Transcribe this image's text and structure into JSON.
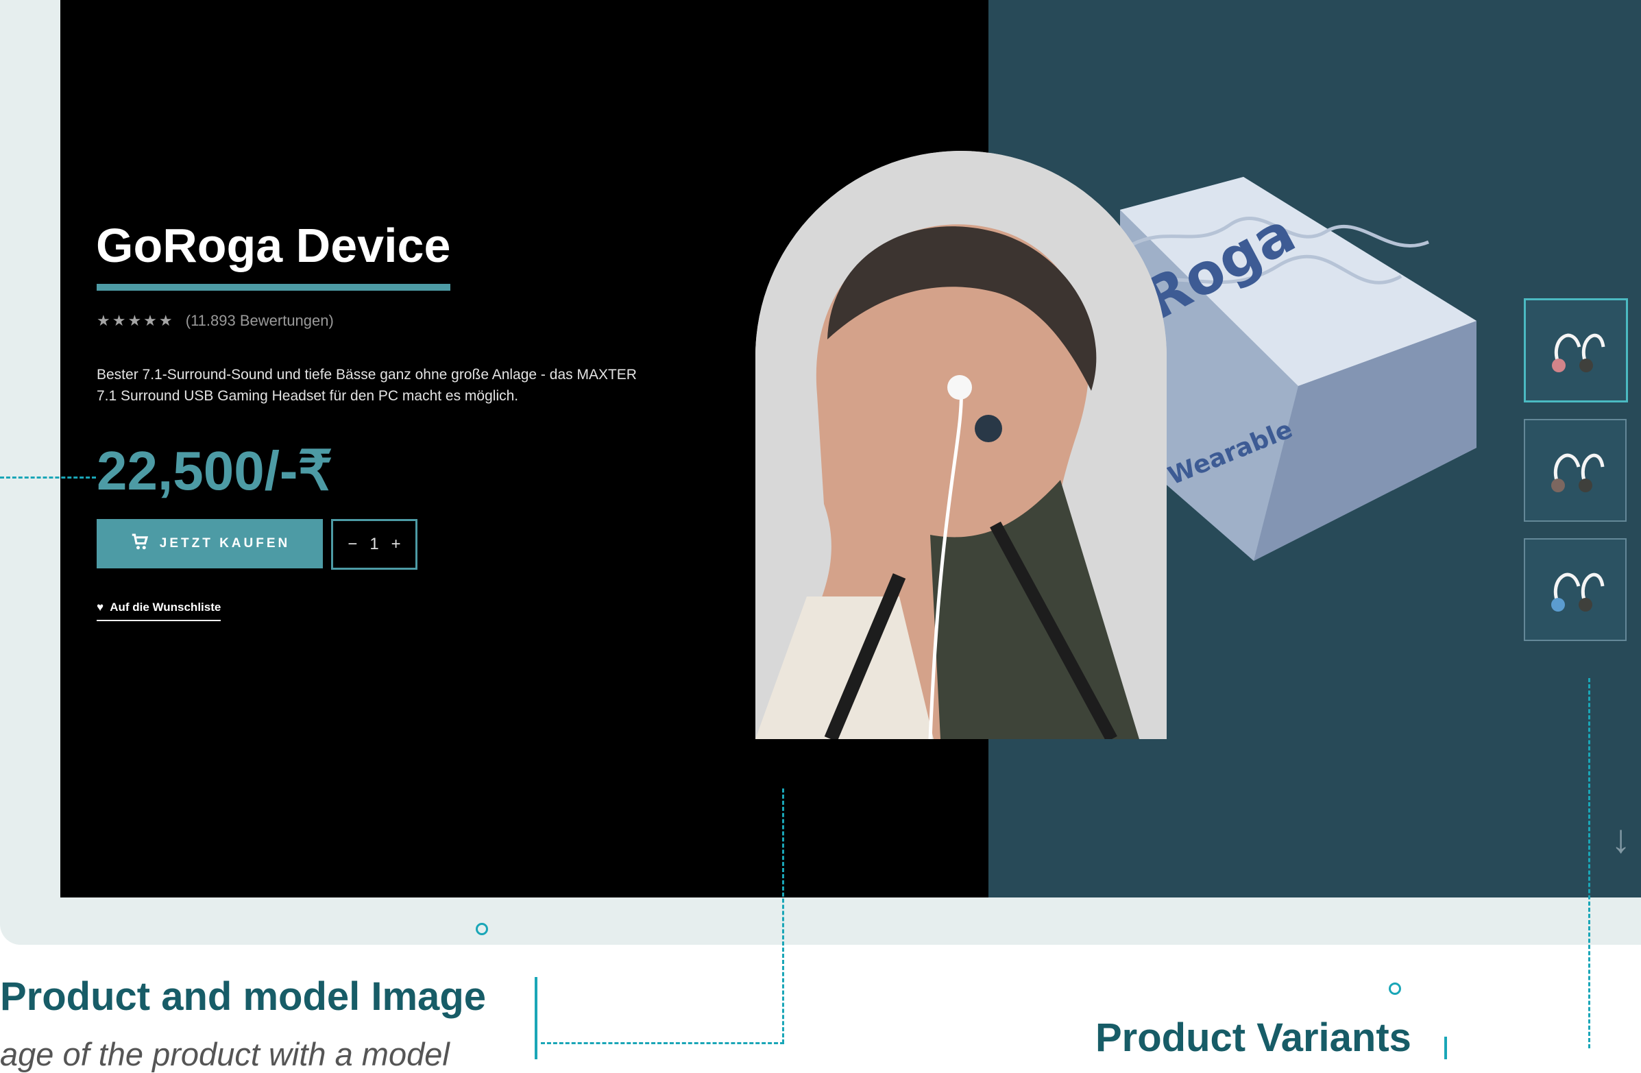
{
  "product": {
    "title": "GoRoga Device",
    "stars": "★★★★★",
    "rating_count": "(11.893 Bewertungen)",
    "description": "Bester 7.1-Surround-Sound und tiefe Bässe ganz ohne große Anlage - das MAXTER 7.1 Surround USB Gaming Headset für den PC macht es möglich.",
    "price": "22,500/-₹",
    "buy_button": "JETZT KAUFEN",
    "quantity": {
      "minus": "−",
      "value": "1",
      "plus": "+"
    },
    "wishlist": "Auf die Wunschliste",
    "box_logo": "Roga",
    "box_text": "ss Wearable"
  },
  "variants": [
    {
      "accent": "#d2848a"
    },
    {
      "accent": "#7c6760"
    },
    {
      "accent": "#5b9ccf"
    }
  ],
  "annotations": {
    "product_image_title": "Product and model Image",
    "product_image_subtitle": "age of the product with a model",
    "variants_title": "Product Variants"
  },
  "colors": {
    "accent": "#4d9ba5",
    "dark_panel": "#284a58",
    "annotation": "#1aa6b7"
  },
  "icons": [
    "cart-icon",
    "heart-icon",
    "down-arrow-icon"
  ]
}
